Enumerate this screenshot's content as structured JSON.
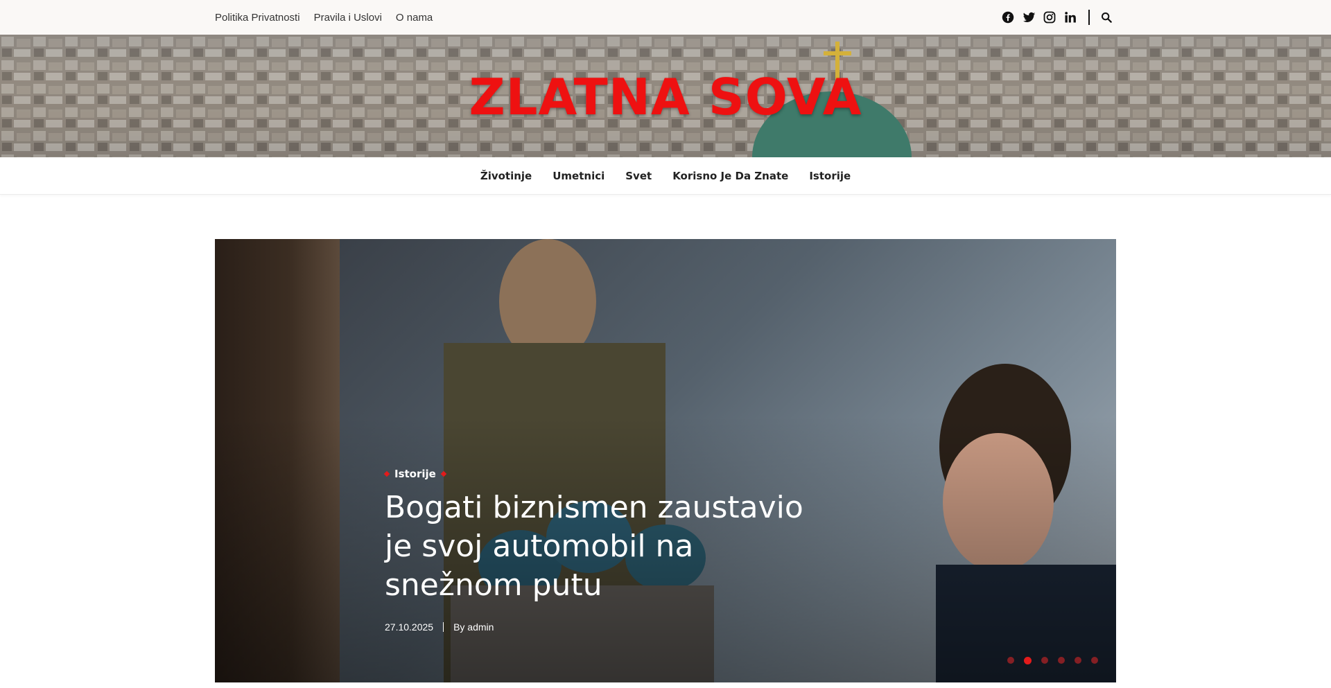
{
  "topbar": {
    "links": [
      "Politika Privatnosti",
      "Pravila i Uslovi",
      "O nama"
    ],
    "social_icons": [
      "facebook-icon",
      "twitter-icon",
      "instagram-icon",
      "linkedin-icon"
    ],
    "search_icon": "search-icon"
  },
  "header": {
    "site_title": "ZLATNA SOVA",
    "title_color": "#ee1111"
  },
  "nav": {
    "items": [
      "Životinje",
      "Umetnici",
      "Svet",
      "Korisno Je Da Znate",
      "Istorije"
    ]
  },
  "hero": {
    "category": "Istorije",
    "title": "Bogati biznismen zaustavio je svoj automobil na snežnom putu",
    "date": "27.10.2025",
    "author": "By admin",
    "slides_count": 6,
    "active_slide": 2,
    "accent_color": "#e31b1b"
  }
}
